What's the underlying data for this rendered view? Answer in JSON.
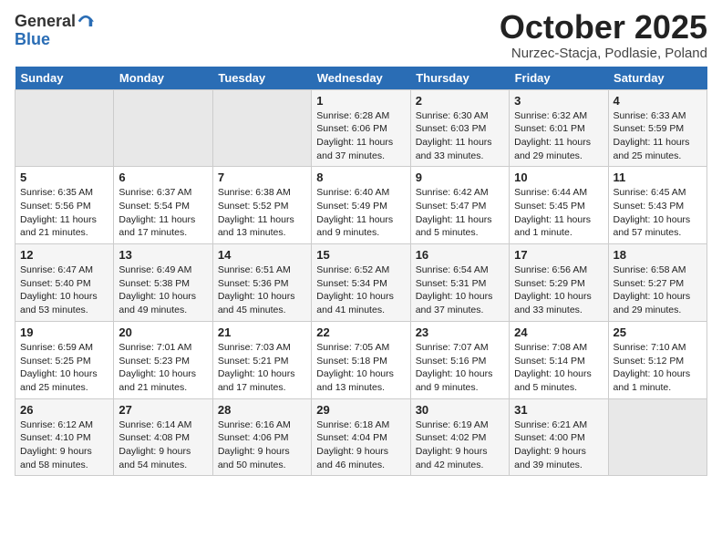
{
  "header": {
    "logo_general": "General",
    "logo_blue": "Blue",
    "month": "October 2025",
    "location": "Nurzec-Stacja, Podlasie, Poland"
  },
  "days_of_week": [
    "Sunday",
    "Monday",
    "Tuesday",
    "Wednesday",
    "Thursday",
    "Friday",
    "Saturday"
  ],
  "weeks": [
    [
      {
        "day": "",
        "info": ""
      },
      {
        "day": "",
        "info": ""
      },
      {
        "day": "",
        "info": ""
      },
      {
        "day": "1",
        "info": "Sunrise: 6:28 AM\nSunset: 6:06 PM\nDaylight: 11 hours\nand 37 minutes."
      },
      {
        "day": "2",
        "info": "Sunrise: 6:30 AM\nSunset: 6:03 PM\nDaylight: 11 hours\nand 33 minutes."
      },
      {
        "day": "3",
        "info": "Sunrise: 6:32 AM\nSunset: 6:01 PM\nDaylight: 11 hours\nand 29 minutes."
      },
      {
        "day": "4",
        "info": "Sunrise: 6:33 AM\nSunset: 5:59 PM\nDaylight: 11 hours\nand 25 minutes."
      }
    ],
    [
      {
        "day": "5",
        "info": "Sunrise: 6:35 AM\nSunset: 5:56 PM\nDaylight: 11 hours\nand 21 minutes."
      },
      {
        "day": "6",
        "info": "Sunrise: 6:37 AM\nSunset: 5:54 PM\nDaylight: 11 hours\nand 17 minutes."
      },
      {
        "day": "7",
        "info": "Sunrise: 6:38 AM\nSunset: 5:52 PM\nDaylight: 11 hours\nand 13 minutes."
      },
      {
        "day": "8",
        "info": "Sunrise: 6:40 AM\nSunset: 5:49 PM\nDaylight: 11 hours\nand 9 minutes."
      },
      {
        "day": "9",
        "info": "Sunrise: 6:42 AM\nSunset: 5:47 PM\nDaylight: 11 hours\nand 5 minutes."
      },
      {
        "day": "10",
        "info": "Sunrise: 6:44 AM\nSunset: 5:45 PM\nDaylight: 11 hours\nand 1 minute."
      },
      {
        "day": "11",
        "info": "Sunrise: 6:45 AM\nSunset: 5:43 PM\nDaylight: 10 hours\nand 57 minutes."
      }
    ],
    [
      {
        "day": "12",
        "info": "Sunrise: 6:47 AM\nSunset: 5:40 PM\nDaylight: 10 hours\nand 53 minutes."
      },
      {
        "day": "13",
        "info": "Sunrise: 6:49 AM\nSunset: 5:38 PM\nDaylight: 10 hours\nand 49 minutes."
      },
      {
        "day": "14",
        "info": "Sunrise: 6:51 AM\nSunset: 5:36 PM\nDaylight: 10 hours\nand 45 minutes."
      },
      {
        "day": "15",
        "info": "Sunrise: 6:52 AM\nSunset: 5:34 PM\nDaylight: 10 hours\nand 41 minutes."
      },
      {
        "day": "16",
        "info": "Sunrise: 6:54 AM\nSunset: 5:31 PM\nDaylight: 10 hours\nand 37 minutes."
      },
      {
        "day": "17",
        "info": "Sunrise: 6:56 AM\nSunset: 5:29 PM\nDaylight: 10 hours\nand 33 minutes."
      },
      {
        "day": "18",
        "info": "Sunrise: 6:58 AM\nSunset: 5:27 PM\nDaylight: 10 hours\nand 29 minutes."
      }
    ],
    [
      {
        "day": "19",
        "info": "Sunrise: 6:59 AM\nSunset: 5:25 PM\nDaylight: 10 hours\nand 25 minutes."
      },
      {
        "day": "20",
        "info": "Sunrise: 7:01 AM\nSunset: 5:23 PM\nDaylight: 10 hours\nand 21 minutes."
      },
      {
        "day": "21",
        "info": "Sunrise: 7:03 AM\nSunset: 5:21 PM\nDaylight: 10 hours\nand 17 minutes."
      },
      {
        "day": "22",
        "info": "Sunrise: 7:05 AM\nSunset: 5:18 PM\nDaylight: 10 hours\nand 13 minutes."
      },
      {
        "day": "23",
        "info": "Sunrise: 7:07 AM\nSunset: 5:16 PM\nDaylight: 10 hours\nand 9 minutes."
      },
      {
        "day": "24",
        "info": "Sunrise: 7:08 AM\nSunset: 5:14 PM\nDaylight: 10 hours\nand 5 minutes."
      },
      {
        "day": "25",
        "info": "Sunrise: 7:10 AM\nSunset: 5:12 PM\nDaylight: 10 hours\nand 1 minute."
      }
    ],
    [
      {
        "day": "26",
        "info": "Sunrise: 6:12 AM\nSunset: 4:10 PM\nDaylight: 9 hours\nand 58 minutes."
      },
      {
        "day": "27",
        "info": "Sunrise: 6:14 AM\nSunset: 4:08 PM\nDaylight: 9 hours\nand 54 minutes."
      },
      {
        "day": "28",
        "info": "Sunrise: 6:16 AM\nSunset: 4:06 PM\nDaylight: 9 hours\nand 50 minutes."
      },
      {
        "day": "29",
        "info": "Sunrise: 6:18 AM\nSunset: 4:04 PM\nDaylight: 9 hours\nand 46 minutes."
      },
      {
        "day": "30",
        "info": "Sunrise: 6:19 AM\nSunset: 4:02 PM\nDaylight: 9 hours\nand 42 minutes."
      },
      {
        "day": "31",
        "info": "Sunrise: 6:21 AM\nSunset: 4:00 PM\nDaylight: 9 hours\nand 39 minutes."
      },
      {
        "day": "",
        "info": ""
      }
    ]
  ]
}
